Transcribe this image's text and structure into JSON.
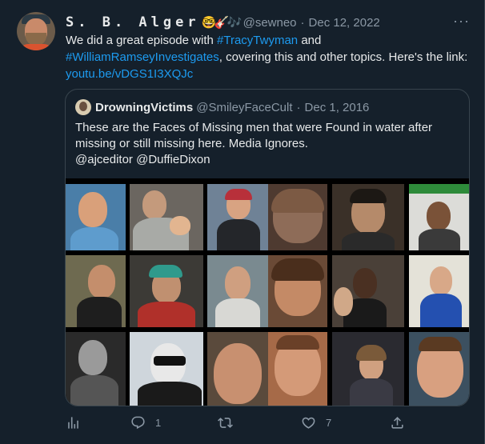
{
  "tweet": {
    "display_name": "S. B. Alger",
    "emojis": [
      "🤓",
      "🎸",
      "🎶"
    ],
    "handle": "@sewneo",
    "separator": "·",
    "date": "Dec 12, 2022",
    "more_label": "···",
    "text_intro": "We did a great episode with ",
    "hashtag_1": "#TracyTwyman",
    "text_and": " and",
    "hashtag_2": "#WilliamRamseyInvestigates",
    "text_after": ", covering this and other topics. Here's the link:",
    "link": "youtu.be/vDGS1I3XQJc"
  },
  "quoted_tweet": {
    "display_name": "DrowningVictims",
    "handle": "@SmileyFaceCult",
    "separator": "·",
    "date": "Dec 1, 2016",
    "text_line_1": "These are the Faces of Missing men that were Found in water after",
    "text_line_2": "missing or still missing here. Media Ignores.",
    "text_line_3": "@ajceditor @DuffieDixon",
    "photo_grid_description": "Collage of 18 portrait photos"
  },
  "actions": {
    "views_icon": "analytics-icon",
    "reply_icon": "reply-icon",
    "reply_count": "1",
    "retweet_icon": "retweet-icon",
    "like_icon": "heart-icon",
    "like_count": "7",
    "share_icon": "share-icon"
  },
  "colors": {
    "background": "#15202b",
    "text_primary": "#e7e9ea",
    "text_secondary": "#8b98a5",
    "link": "#1d9bf0",
    "border": "#38444d"
  }
}
